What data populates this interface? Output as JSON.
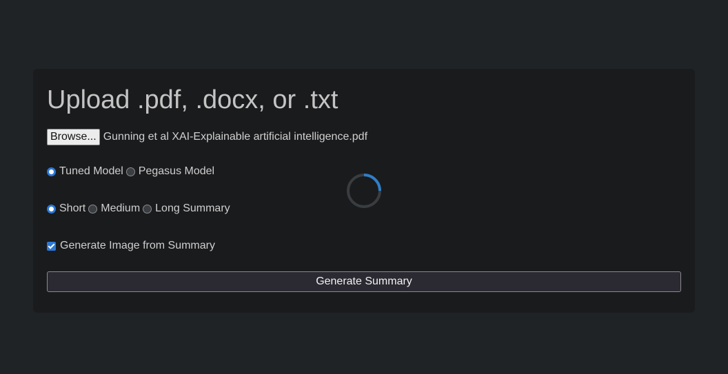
{
  "form": {
    "title": "Upload .pdf, .docx, or .txt",
    "browse_label": "Browse...",
    "file_name": "Gunning et al XAI-Explainable artificial intelligence.pdf",
    "model_options": [
      {
        "label": "Tuned Model",
        "checked": true
      },
      {
        "label": "Pegasus Model",
        "checked": false
      }
    ],
    "length_options": [
      {
        "label": "Short",
        "checked": true
      },
      {
        "label": "Medium",
        "checked": false
      },
      {
        "label": "Long Summary",
        "checked": false
      }
    ],
    "image_option": {
      "label": "Generate Image from Summary",
      "checked": true
    },
    "generate_label": "Generate Summary"
  },
  "colors": {
    "page_bg": "#202326",
    "card_bg": "#1a1b1d",
    "accent": "#2d78d6",
    "spinner_track": "#3a3d40",
    "spinner_arc": "#2f7fc7"
  }
}
